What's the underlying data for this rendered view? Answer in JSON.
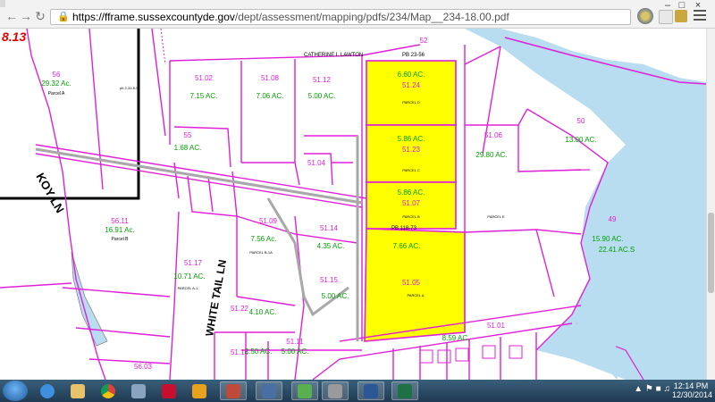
{
  "browser": {
    "url_host": "https://fframe.sussexcountyde.gov",
    "url_path": "/dept/assessment/mapping/pdfs/234/Map__234-18.00.pdf",
    "back_icon": "back-arrow-icon",
    "forward_icon": "forward-arrow-icon",
    "reload_icon": "reload-icon",
    "lock_icon": "lock-icon",
    "menu_icon": "hamburger-menu-icon"
  },
  "map": {
    "corner_label": "8.13",
    "parcels": [
      {
        "id": "56",
        "acres": "29.32 Ac.",
        "name": "Parcel A"
      },
      {
        "id": "51.02",
        "acres": "7.15 AC."
      },
      {
        "id": "51.08",
        "acres": "7.06 AC."
      },
      {
        "id": "51.12",
        "acres": "5.00 AC."
      },
      {
        "id": "51.24",
        "acres": "6.60 AC.",
        "name": "PARCEL D"
      },
      {
        "id": "51.23",
        "acres": "5.86 AC.",
        "name": "PARCEL C"
      },
      {
        "id": "51.07",
        "acres": "5.86 AC.",
        "name": "PARCEL B"
      },
      {
        "id": "51.05",
        "acres": "7.66 AC.",
        "name": "PARCEL A"
      },
      {
        "id": "51.06",
        "acres": "29.80 AC.",
        "name": "PARCEL E"
      },
      {
        "id": "50",
        "acres": "13.00 AC."
      },
      {
        "id": "49",
        "acres": "15.90 AC.",
        "acres2": "22.41 AC.S"
      },
      {
        "id": "55",
        "acres": "1.68 AC."
      },
      {
        "id": "51.04"
      },
      {
        "id": "56.11",
        "acres": "16.91 Ac.",
        "name": "Parcel B"
      },
      {
        "id": "51.09",
        "acres": "7.56 Ac.",
        "name": "PARCEL B-1A"
      },
      {
        "id": "51.14",
        "acres": "4.35 AC."
      },
      {
        "id": "51.15",
        "acres": "5.00 AC."
      },
      {
        "id": "51.17",
        "acres": "10.71 AC.",
        "name": "PARCEL A-1"
      },
      {
        "id": "51.22",
        "acres": "4.10 AC."
      },
      {
        "id": "51.16",
        "acres": "2.50 AC."
      },
      {
        "id": "51.11",
        "acres": "5.00 AC."
      },
      {
        "id": "51.01",
        "acres": "8.59 AC."
      },
      {
        "id": "56.03"
      },
      {
        "id": "52"
      }
    ],
    "owner_label": "CATHERINE I. LAWTON",
    "plat_ref1": "PB 23-56",
    "plat_ref2": "PB 118-73",
    "plat_ref3": "pb 2-34 8-56",
    "road1": "KOY LN",
    "road2": "WHITE TAIL LN",
    "colors": {
      "parcel_line": "#e020d8",
      "highlight": "#ffff00",
      "water": "#b8dcf0",
      "road": "#a8a8a8"
    }
  },
  "taskbar": {
    "clock_time": "12:14 PM",
    "clock_date": "12/30/2014",
    "apps": [
      "ie-icon",
      "file-explorer-icon",
      "chrome-icon",
      "media-icon",
      "acrobat-icon",
      "outlook-icon",
      "app-icon",
      "access-icon",
      "games-icon",
      "tools-icon",
      "word-icon",
      "excel-icon"
    ]
  }
}
